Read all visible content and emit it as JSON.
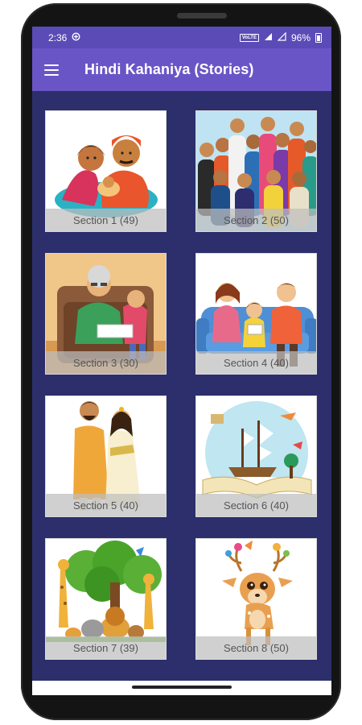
{
  "status_bar": {
    "time": "2:36",
    "network": "VoLTE",
    "battery": "96%"
  },
  "app_bar": {
    "title": "Hindi Kahaniya (Stories)",
    "menu_icon": "hamburger-menu-icon"
  },
  "sections": [
    {
      "label": "Section 1 (49)",
      "image": "couple-with-baby"
    },
    {
      "label": "Section 2 (50)",
      "image": "crowd-of-people"
    },
    {
      "label": "Section 3 (30)",
      "image": "grandmother-reading"
    },
    {
      "label": "Section 4 (40)",
      "image": "family-on-sofa"
    },
    {
      "label": "Section 5 (40)",
      "image": "indian-couple"
    },
    {
      "label": "Section 6 (40)",
      "image": "ship-on-open-book"
    },
    {
      "label": "Section 7 (39)",
      "image": "jungle-animals"
    },
    {
      "label": "Section 8 (50)",
      "image": "deer-with-birds"
    }
  ],
  "colors": {
    "status_bar": "#5a4bb7",
    "app_bar": "#6a55c7",
    "background": "#2c2f6b",
    "caption_overlay": "#bebebe"
  }
}
